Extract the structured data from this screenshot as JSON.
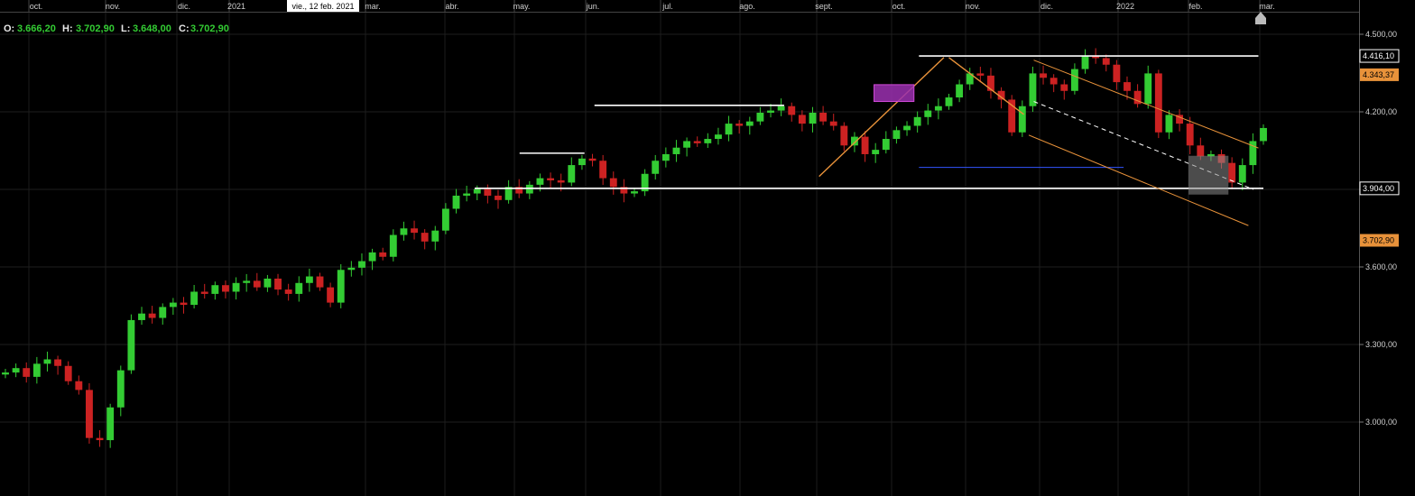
{
  "ohlc": {
    "o_label": "O:",
    "o_value": "3.666,20",
    "h_label": "H:",
    "h_value": "3.702,90",
    "l_label": "L:",
    "l_value": "3.648,00",
    "c_label": "C:",
    "c_value": "3.702,90"
  },
  "crosshair_date": "vie., 12 feb. 2021",
  "colors": {
    "background": "#000000",
    "up_candle": "#33cc33",
    "down_candle": "#cc2222",
    "white_line": "#ffffff",
    "orange_line": "#e8923a",
    "blue_line": "#3355ff",
    "purple_box": "#9b30b0",
    "grey_box": "#8a8a8a",
    "tag_orange": "#e8923a"
  },
  "price_tags": [
    {
      "label": "4.416,10",
      "value": 4416.1,
      "style": "white"
    },
    {
      "label": "4.343,37",
      "value": 4343.37,
      "style": "orange"
    },
    {
      "label": "3.904,00",
      "value": 3904.0,
      "style": "white"
    },
    {
      "label": "3.702,90",
      "value": 3702.9,
      "style": "orange"
    }
  ],
  "chart_data": {
    "type": "candlestick",
    "x_axis": {
      "ticks": [
        "oct.",
        "nov.",
        "dic.",
        "2021",
        "mar.",
        "abr.",
        "may.",
        "jun.",
        "jul.",
        "ago.",
        "sept.",
        "oct.",
        "nov.",
        "dic.",
        "2022",
        "feb.",
        "mar."
      ]
    },
    "y_axis": {
      "ticks": [
        "3.000,00",
        "3.300,00",
        "3.600,00",
        "3.900,00",
        "4.200,00",
        "4.500,00"
      ],
      "tick_values": [
        3000,
        3300,
        3600,
        3900,
        4200,
        4500
      ],
      "range": [
        2700,
        4580
      ],
      "grid": true
    },
    "series": [
      {
        "closes": [
          3330,
          3350,
          3310,
          3370,
          3390,
          3360,
          3290,
          3250,
          3030,
          3020,
          3170,
          3340,
          3570,
          3600,
          3580,
          3630,
          3650,
          3640,
          3700,
          3690,
          3730,
          3700,
          3740,
          3750,
          3720,
          3760,
          3710,
          3690,
          3740,
          3770,
          3720,
          3650,
          3800,
          3810,
          3840,
          3880,
          3860,
          3960,
          3990,
          3970,
          3930,
          3980,
          4080,
          4140,
          4150,
          4170,
          4140,
          4120,
          4180,
          4150,
          4190,
          4220,
          4210,
          4200,
          4280,
          4310,
          4300,
          4220,
          4180,
          4150,
          4160,
          4240,
          4300,
          4330,
          4360,
          4390,
          4380,
          4400,
          4420,
          4470,
          4460,
          4480,
          4520,
          4530,
          4550,
          4510,
          4470,
          4520,
          4480,
          4460,
          4370,
          4410,
          4330,
          4350,
          4400,
          4440,
          4460,
          4500,
          4530,
          4550,
          4590,
          4650,
          4700,
          4690,
          4620,
          4580,
          4430,
          4550,
          4700,
          4680,
          4650,
          4620,
          4720,
          4780,
          4770,
          4740,
          4660,
          4620,
          4560,
          4700,
          4430,
          4510,
          4470,
          4370,
          4320,
          4330,
          4290,
          4200,
          4280,
          4390,
          4450
        ]
      }
    ],
    "annotations": [
      {
        "kind": "hline",
        "color": "white",
        "start": 183,
        "end": 251,
        "value": 4416.1
      },
      {
        "kind": "hline",
        "color": "white",
        "start": 94,
        "end": 252,
        "value": 3904.0
      },
      {
        "kind": "hline",
        "color": "white",
        "start": 118,
        "end": 156,
        "value": 4225
      },
      {
        "kind": "hline",
        "color": "white",
        "start": 103,
        "end": 116,
        "value": 4040
      },
      {
        "kind": "hline",
        "color": "blue",
        "start": 183,
        "end": 224,
        "value": 3985
      },
      {
        "kind": "trend",
        "color": "orange",
        "from": [
          163,
          3950
        ],
        "to": [
          188,
          4410
        ]
      },
      {
        "kind": "trend",
        "color": "orange",
        "from": [
          189,
          4410
        ],
        "to": [
          204,
          4190
        ]
      },
      {
        "kind": "channel",
        "color": "orange",
        "upper_from": [
          206,
          4400
        ],
        "upper_to": [
          251,
          4060
        ],
        "lower_from": [
          205,
          4110
        ],
        "lower_to": [
          249,
          3760
        ]
      },
      {
        "kind": "dashed",
        "color": "white",
        "from": [
          206,
          4240
        ],
        "to": [
          250,
          3900
        ]
      },
      {
        "kind": "box",
        "color": "purple",
        "t0": 174,
        "t1": 182,
        "v0": 4240,
        "v1": 4305
      },
      {
        "kind": "box",
        "color": "grey",
        "t0": 237,
        "t1": 245,
        "v0": 3880,
        "v1": 4030
      }
    ]
  }
}
